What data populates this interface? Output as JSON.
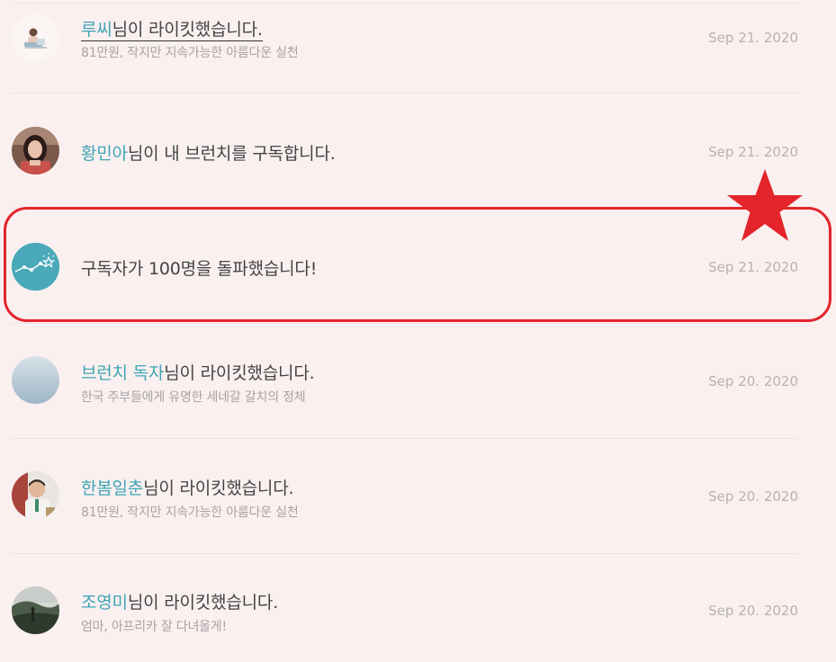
{
  "notifications": [
    {
      "name": "루씨",
      "action": "님이 라이킷했습니다.",
      "subtitle": "81만원, 작지만 지속가능한 아름다운 실천",
      "date": "Sep 21. 2020",
      "avatar": "laptop-woman-icon"
    },
    {
      "name": "황민아",
      "action": "님이 내 브런치를 구독합니다.",
      "subtitle": "",
      "date": "Sep 21. 2020",
      "avatar": "woman-photo"
    },
    {
      "name": "",
      "action": "구독자가 100명을 돌파했습니다!",
      "subtitle": "",
      "date": "Sep 21. 2020",
      "avatar": "milestone-chart-icon"
    },
    {
      "name": "브런치 독자",
      "action": "님이 라이킷했습니다.",
      "subtitle": "한국 주부들에게 유명한 세네갈 갈치의 정체",
      "date": "Sep 20. 2020",
      "avatar": "default-gradient-avatar"
    },
    {
      "name": "한봄일춘",
      "action": "님이 라이킷했습니다.",
      "subtitle": "81만원, 작지만 지속가능한 아름다운 실천",
      "date": "Sep 20. 2020",
      "avatar": "man-photo"
    },
    {
      "name": "조영미",
      "action": "님이 라이킷했습니다.",
      "subtitle": "엄마, 아프리카 잘 다녀올게!",
      "date": "Sep 20. 2020",
      "avatar": "landscape-photo"
    }
  ],
  "colors": {
    "name_accent": "#3fa5b4",
    "highlight": "#e3242b",
    "background": "#faf0f0"
  }
}
